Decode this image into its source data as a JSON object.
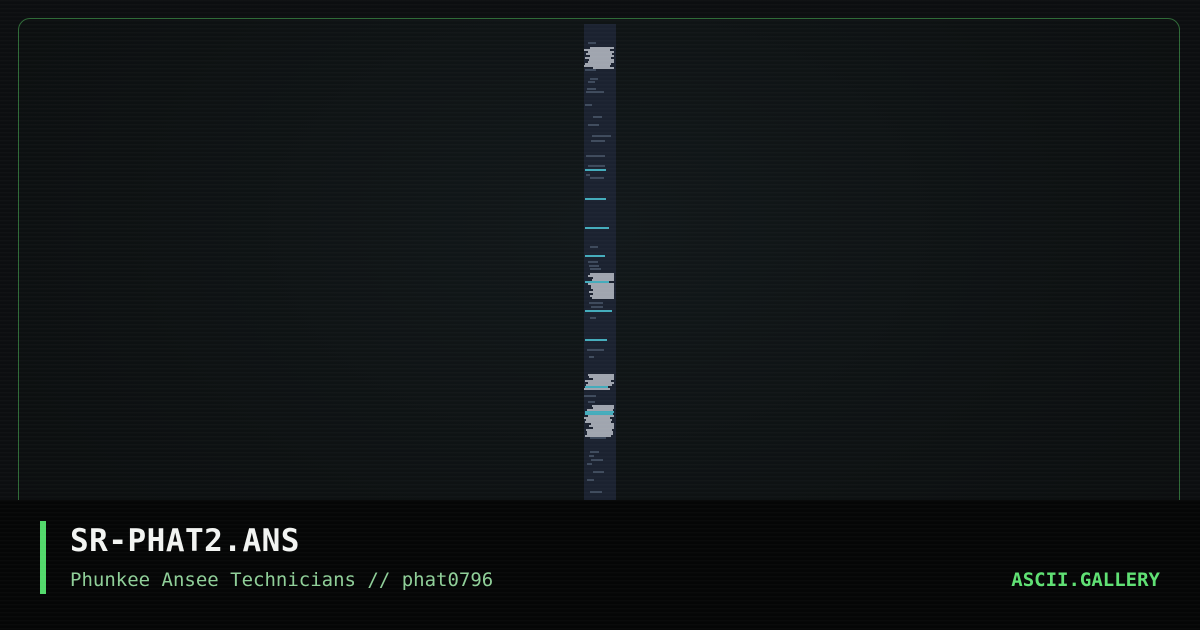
{
  "artwork": {
    "title": "SR-PHAT2.ANS",
    "credits": "Phunkee Ansee Technicians // phat0796"
  },
  "site": {
    "brand": "ASCII.GALLERY"
  },
  "colors": {
    "frame_border": "#2f6b38",
    "accent_bar": "#52d96b",
    "title_text": "#f2f4f2",
    "subtitle_text": "#8fcf98",
    "brand_text": "#5fe073",
    "background": "#0c0e10",
    "info_bar_background": "#050606",
    "art_background": "#1b2230"
  }
}
